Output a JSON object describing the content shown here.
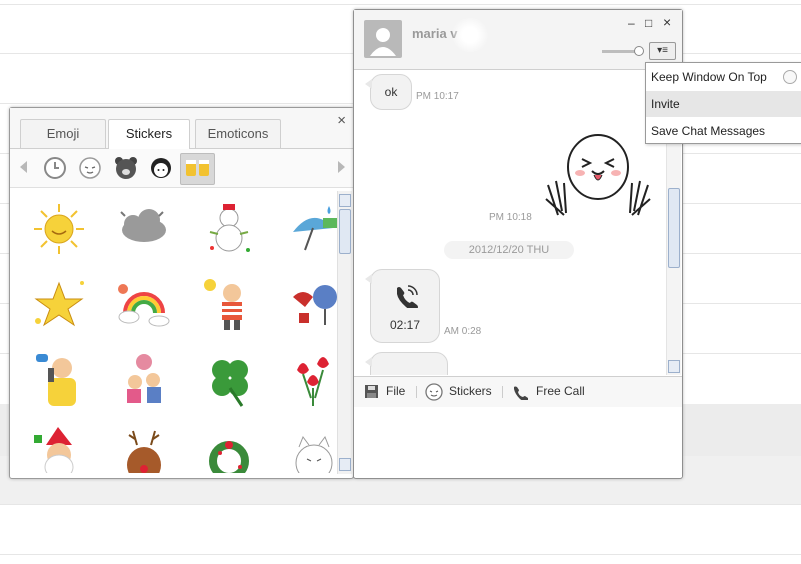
{
  "sticker_panel": {
    "tabs": [
      {
        "label": "Emoji",
        "active": false
      },
      {
        "label": "Stickers",
        "active": true
      },
      {
        "label": "Emoticons",
        "active": false
      }
    ],
    "close": "×",
    "categories": [
      "recent-icon",
      "moon-face-icon",
      "brown-bear-icon",
      "girl-icon",
      "cheers-icon"
    ],
    "stickers": [
      "sun-sticker",
      "cloud-sticker",
      "snowman-sticker",
      "umbrella-sticker",
      "star-sticker",
      "rainbow-sticker",
      "sunny-man-sticker",
      "fan-girl-sticker",
      "phone-man-sticker",
      "couple-sticker",
      "clover-sticker",
      "tulip-sticker",
      "santa-sticker",
      "reindeer-sticker",
      "wreath-sticker",
      "lucky-cat-sticker"
    ]
  },
  "chat": {
    "contact_name": "maria v",
    "window_buttons": {
      "minimize": "–",
      "maximize": "□",
      "close": "×"
    },
    "menu_button": "▾≡",
    "messages": [
      {
        "text": "ok",
        "time": "PM 10:17"
      },
      {
        "time": "PM 10:18"
      },
      {
        "date": "2012/12/20 THU"
      },
      {
        "call_duration": "02:17",
        "time": "AM 0:28"
      }
    ],
    "toolbar": {
      "file": "File",
      "stickers": "Stickers",
      "free_call": "Free Call"
    }
  },
  "menu": {
    "items": [
      {
        "label": "Keep Window On Top"
      },
      {
        "label": "Invite"
      },
      {
        "label": "Save Chat Messages"
      }
    ]
  },
  "colors": {
    "accent": "#5a8fd0",
    "window_border": "#8f8f8f"
  }
}
